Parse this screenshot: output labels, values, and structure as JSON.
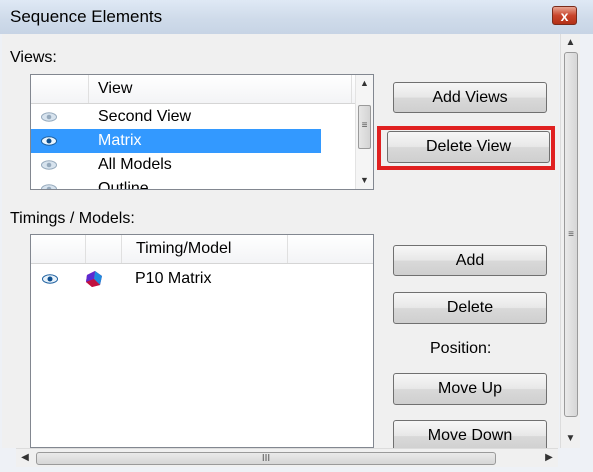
{
  "window": {
    "title": "Sequence Elements",
    "close_glyph": "x"
  },
  "views": {
    "label": "Views:",
    "column_header": "View",
    "items": [
      {
        "label": "Second View",
        "selected": false
      },
      {
        "label": "Matrix",
        "selected": true
      },
      {
        "label": "All Models",
        "selected": false
      },
      {
        "label": "Outline",
        "selected": false
      }
    ]
  },
  "view_buttons": {
    "add": "Add Views",
    "delete": "Delete View"
  },
  "timings": {
    "label": "Timings / Models:",
    "column_header": "Timing/Model",
    "items": [
      {
        "label": "P10 Matrix"
      }
    ]
  },
  "timing_buttons": {
    "add": "Add",
    "delete": "Delete",
    "position_label": "Position:",
    "move_up": "Move Up",
    "move_down": "Move Down"
  },
  "icons": {
    "eye": "eye-icon",
    "model": "model-icon",
    "scroll_up": "▲",
    "scroll_down": "▼",
    "scroll_left": "◀",
    "scroll_right": "▶",
    "grip_vertical": "≡",
    "grip_horizontal": "III"
  },
  "colors": {
    "selection": "#3399ff",
    "highlight": "#e02020"
  }
}
